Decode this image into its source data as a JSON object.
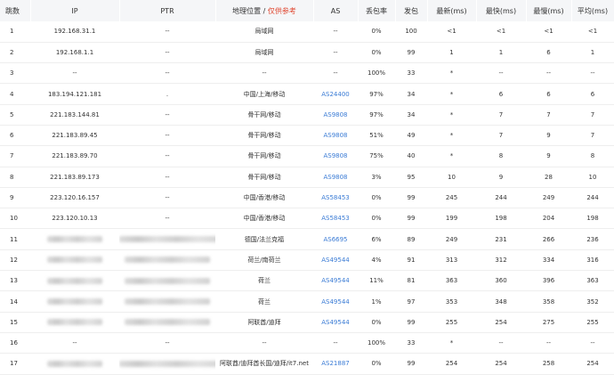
{
  "headers": {
    "hop": "跳数",
    "ip": "IP",
    "ptr": "PTR",
    "geo": "地理位置",
    "geo_separator": " / ",
    "geo_note": "仅供参考",
    "as": "AS",
    "loss": "丢包率",
    "sent": "发包",
    "last": "最新(ms)",
    "best": "最快(ms)",
    "worst": "最慢(ms)",
    "avg": "平均(ms)"
  },
  "colors": {
    "header_bg": "#f5f6f8",
    "link": "#3a7bd5",
    "note_red": "#e0462f",
    "row_border": "#eeeeee"
  },
  "rows": [
    {
      "hop": "1",
      "ip": "192.168.31.1",
      "ptr": "--",
      "geo": "局域网",
      "as": "--",
      "loss": "0%",
      "sent": "100",
      "last": "<1",
      "best": "<1",
      "worst": "<1",
      "avg": "<1"
    },
    {
      "hop": "2",
      "ip": "192.168.1.1",
      "ptr": "--",
      "geo": "局域网",
      "as": "--",
      "loss": "0%",
      "sent": "99",
      "last": "1",
      "best": "1",
      "worst": "6",
      "avg": "1"
    },
    {
      "hop": "3",
      "ip": "--",
      "ptr": "--",
      "geo": "--",
      "as": "--",
      "loss": "100%",
      "sent": "33",
      "last": "*",
      "best": "--",
      "worst": "--",
      "avg": "--"
    },
    {
      "hop": "4",
      "ip": "183.194.121.181",
      "ptr": ".",
      "geo": "中国/上海/移动",
      "as": "AS24400",
      "loss": "97%",
      "sent": "34",
      "last": "*",
      "best": "6",
      "worst": "6",
      "avg": "6"
    },
    {
      "hop": "5",
      "ip": "221.183.144.81",
      "ptr": "--",
      "geo": "骨干网/移动",
      "as": "AS9808",
      "loss": "97%",
      "sent": "34",
      "last": "*",
      "best": "7",
      "worst": "7",
      "avg": "7"
    },
    {
      "hop": "6",
      "ip": "221.183.89.45",
      "ptr": "--",
      "geo": "骨干网/移动",
      "as": "AS9808",
      "loss": "51%",
      "sent": "49",
      "last": "*",
      "best": "7",
      "worst": "9",
      "avg": "7"
    },
    {
      "hop": "7",
      "ip": "221.183.89.70",
      "ptr": "--",
      "geo": "骨干网/移动",
      "as": "AS9808",
      "loss": "75%",
      "sent": "40",
      "last": "*",
      "best": "8",
      "worst": "9",
      "avg": "8"
    },
    {
      "hop": "8",
      "ip": "221.183.89.173",
      "ptr": "--",
      "geo": "骨干网/移动",
      "as": "AS9808",
      "loss": "3%",
      "sent": "95",
      "last": "10",
      "best": "9",
      "worst": "28",
      "avg": "10"
    },
    {
      "hop": "9",
      "ip": "223.120.16.157",
      "ptr": "--",
      "geo": "中国/香港/移动",
      "as": "AS58453",
      "loss": "0%",
      "sent": "99",
      "last": "245",
      "best": "244",
      "worst": "249",
      "avg": "244"
    },
    {
      "hop": "10",
      "ip": "223.120.10.13",
      "ptr": "--",
      "geo": "中国/香港/移动",
      "as": "AS58453",
      "loss": "0%",
      "sent": "99",
      "last": "199",
      "best": "198",
      "worst": "204",
      "avg": "198"
    },
    {
      "hop": "11",
      "ip": "",
      "ptr": "",
      "geo": "德国/法兰克福",
      "as": "AS6695",
      "loss": "6%",
      "sent": "89",
      "last": "249",
      "best": "231",
      "worst": "266",
      "avg": "236"
    },
    {
      "hop": "12",
      "ip": "",
      "ptr": "",
      "geo": "荷兰/南荷兰",
      "as": "AS49544",
      "loss": "4%",
      "sent": "91",
      "last": "313",
      "best": "312",
      "worst": "334",
      "avg": "316"
    },
    {
      "hop": "13",
      "ip": "",
      "ptr": "",
      "geo": "荷兰",
      "as": "AS49544",
      "loss": "11%",
      "sent": "81",
      "last": "363",
      "best": "360",
      "worst": "396",
      "avg": "363"
    },
    {
      "hop": "14",
      "ip": "",
      "ptr": "",
      "geo": "荷兰",
      "as": "AS49544",
      "loss": "1%",
      "sent": "97",
      "last": "353",
      "best": "348",
      "worst": "358",
      "avg": "352"
    },
    {
      "hop": "15",
      "ip": "",
      "ptr": "",
      "geo": "阿联酋/迪拜",
      "as": "AS49544",
      "loss": "0%",
      "sent": "99",
      "last": "255",
      "best": "254",
      "worst": "275",
      "avg": "255"
    },
    {
      "hop": "16",
      "ip": "--",
      "ptr": "--",
      "geo": "--",
      "as": "--",
      "loss": "100%",
      "sent": "33",
      "last": "*",
      "best": "--",
      "worst": "--",
      "avg": "--"
    },
    {
      "hop": "17",
      "ip": "",
      "ptr": "",
      "geo": "阿联酋/迪拜酋长国/迪拜/it7.net",
      "as": "AS21887",
      "loss": "0%",
      "sent": "99",
      "last": "254",
      "best": "254",
      "worst": "258",
      "avg": "254"
    }
  ]
}
